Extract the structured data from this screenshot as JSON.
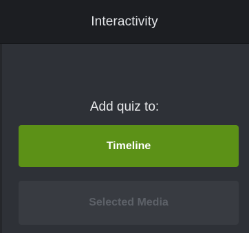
{
  "header": {
    "title": "Interactivity"
  },
  "main": {
    "prompt": "Add quiz to:",
    "buttons": {
      "timeline": "Timeline",
      "selected_media": "Selected Media"
    }
  },
  "colors": {
    "header_bg": "#1c1e22",
    "panel_bg": "#2e3137",
    "primary_button": "#5c9117",
    "disabled_button": "#383b41"
  }
}
